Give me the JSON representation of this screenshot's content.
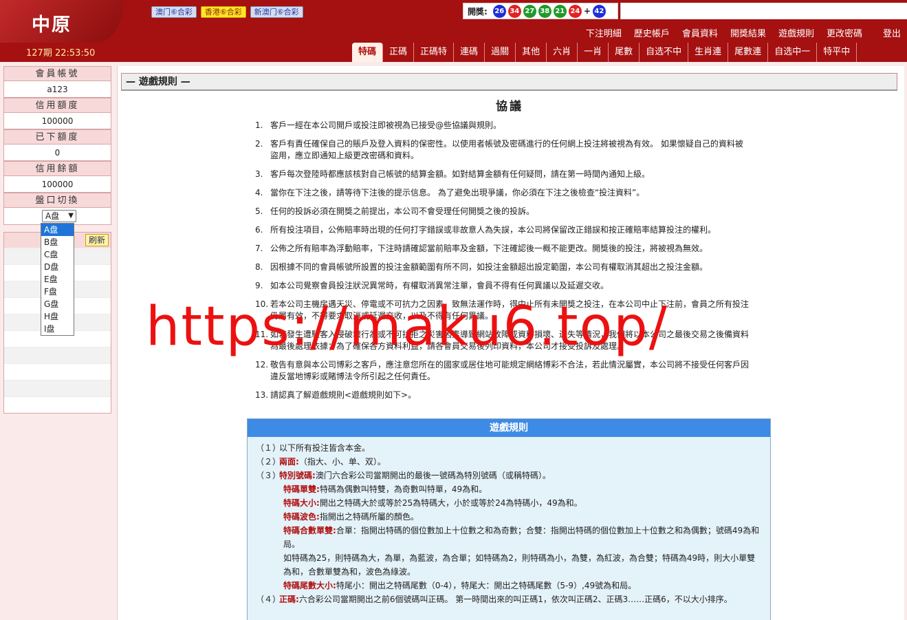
{
  "header": {
    "logo": "中原",
    "period": "127期 22:53:50",
    "lottery_tabs": [
      "澳门⑥合彩",
      "香港⑥合彩",
      "新澳门⑥合彩"
    ],
    "draw_label": "開獎:",
    "draw_numbers": [
      {
        "n": "26",
        "color": "#1d2fd6"
      },
      {
        "n": "34",
        "color": "#e02222"
      },
      {
        "n": "27",
        "color": "#1f9a2a"
      },
      {
        "n": "38",
        "color": "#1f9a2a"
      },
      {
        "n": "21",
        "color": "#1f9a2a"
      },
      {
        "n": "24",
        "color": "#e02222"
      },
      {
        "n": "42",
        "color": "#1d2fd6"
      }
    ],
    "draw_plus": "+",
    "top_menu": [
      "下注明細",
      "歷史帳戶",
      "會員資料",
      "開獎結果",
      "遊戲規則",
      "更改密碼"
    ],
    "logout": "登出",
    "bet_tabs": [
      "特碼",
      "正碼",
      "正碼特",
      "連碼",
      "過關",
      "其他",
      "六肖",
      "一肖",
      "尾數",
      "自选不中",
      "生肖連",
      "尾數連",
      "自选中一",
      "特平中"
    ]
  },
  "sidebar": {
    "account_label": "會員帳號",
    "account": "a123",
    "credit_label": "信用額度",
    "credit": "100000",
    "placed_label": "已下額度",
    "placed": "0",
    "balance_label": "信用餘額",
    "balance": "100000",
    "switch_label": "盤口切換",
    "selected_pan": "A盘",
    "pan_options": [
      "A盘",
      "B盘",
      "C盘",
      "D盘",
      "E盘",
      "F盘",
      "G盘",
      "H盘",
      "I盘"
    ],
    "refresh": "刷新"
  },
  "main": {
    "section_title": "— 遊戲規則 —",
    "agreement_title": "協議",
    "rules": [
      "客戶一經在本公司開戶或投注即被視為已接受@些協議與規則。",
      "客戶有責任確保自己的賬戶及登入資料的保密性。以使用者帳號及密碼進行的任何網上投注將被視為有效。 如果懷疑自己的資料被盜用，應立即通知上級更改密碼和資料。",
      "客戶每次登陸時都應該核對自己帳號的結算金額。如對結算金額有任何疑問，請在第一時間內通知上級。",
      "當你在下注之後，請等待下注後的提示信息。 為了避免出現爭議，你必須在下注之後檢查“投注資料”。",
      "任何的投訴必須在開獎之前提出，本公司不會受理任何開獎之後的投訴。",
      "所有投注項目，公佈賠率時出現的任何打字錯誤或非故意人為失誤，本公司將保留改正錯誤和按正確賠率結算投注的權利。",
      "公佈之所有賠率為浮動賠率，下注時請確認當前賠率及金額，下注確認後一概不能更改。開獎後的投注，將被視為無效。",
      "因根據不同的會員帳號所設置的投注金額範圍有所不同，如投注金額超出設定範圍，本公司有權取消其超出之投注金額。",
      "如本公司覺察會員投注狀況異常時，有權取消異常注單，會員不得有任何異議以及延遲交收。",
      "若本公司主機房遇天災、停電或不可抗力之因素，致無法運作時，得中止所有未開獎之投注，在本公司中止下注前，會員之所有投注仍屬有效，不得要求取消或延遲交收，以及不得有任何異議。",
      "如若發生遭駭客入侵破壞行為或不可抗拒之災害因素導致網站故障或資料損壞、遺失等情況，我們將以本公司之最後交易之後備資料為最後處理依據；為了確保各方資料利益，請各會員交易後列印資料，本公司才接受投訴及處理。",
      "敬告有意與本公司博彩之客戶，應注意您所在的國家或居住地可能規定網絡博彩不合法，若此情況屬實，本公司將不接受任何客戶因違反當地博彩或賭博法令所引起之任何責任。",
      "請認真了解遊戲規則<遊戲規則如下>。"
    ],
    "game_rules_title": "遊戲規則",
    "gr1": "以下所有投注皆含本金。",
    "gr2_key": "兩面:",
    "gr2": "（指大、小、单、双）。",
    "gr3_key": "特別號碼:",
    "gr3": "澳门六合彩公司當期開出的最後一號碼為特別號碼（或稱特碼）。",
    "gr3a_key": "特碼單雙:",
    "gr3a": "特碼為偶數叫特雙，為奇數叫特單，49為和。",
    "gr3b_key": "特碼大小:",
    "gr3b": "開出之特碼大於或等於25為特碼大，小於或等於24為特碼小，49為和。",
    "gr3c_key": "特碼波色:",
    "gr3c": "指開出之特碼所屬的顏色。",
    "gr3d_key": "特碼合數單雙:",
    "gr3d": "合單：指開出特碼的個位數加上十位數之和為奇數；合雙：指開出特碼的個位數加上十位數之和為偶數；號碼49為和局。",
    "gr3e": "如特碼為25，則特碼為大，為單，為藍波，為合單；如特碼為2，則特碼為小，為雙，為紅波，為合雙；特碼為49時，則大小單雙為和，合數單雙為和，波色為綠波。",
    "gr3f_key": "特碼尾數大小:",
    "gr3f": "特尾小：開出之特碼尾數（0-4），特尾大：開出之特碼尾數（5-9）,49號為和局。",
    "gr4_key": "正碼:",
    "gr4": "六合彩公司當期開出之前6個號碼叫正碼。 第一時間出來的叫正碼1，依次叫正碼2、正碼3……正碼6，不以大小排序。",
    "gr_nums": [
      "（１）",
      "（２）",
      "（３）",
      "（４）"
    ]
  },
  "watermark": "https://maku6.top/"
}
